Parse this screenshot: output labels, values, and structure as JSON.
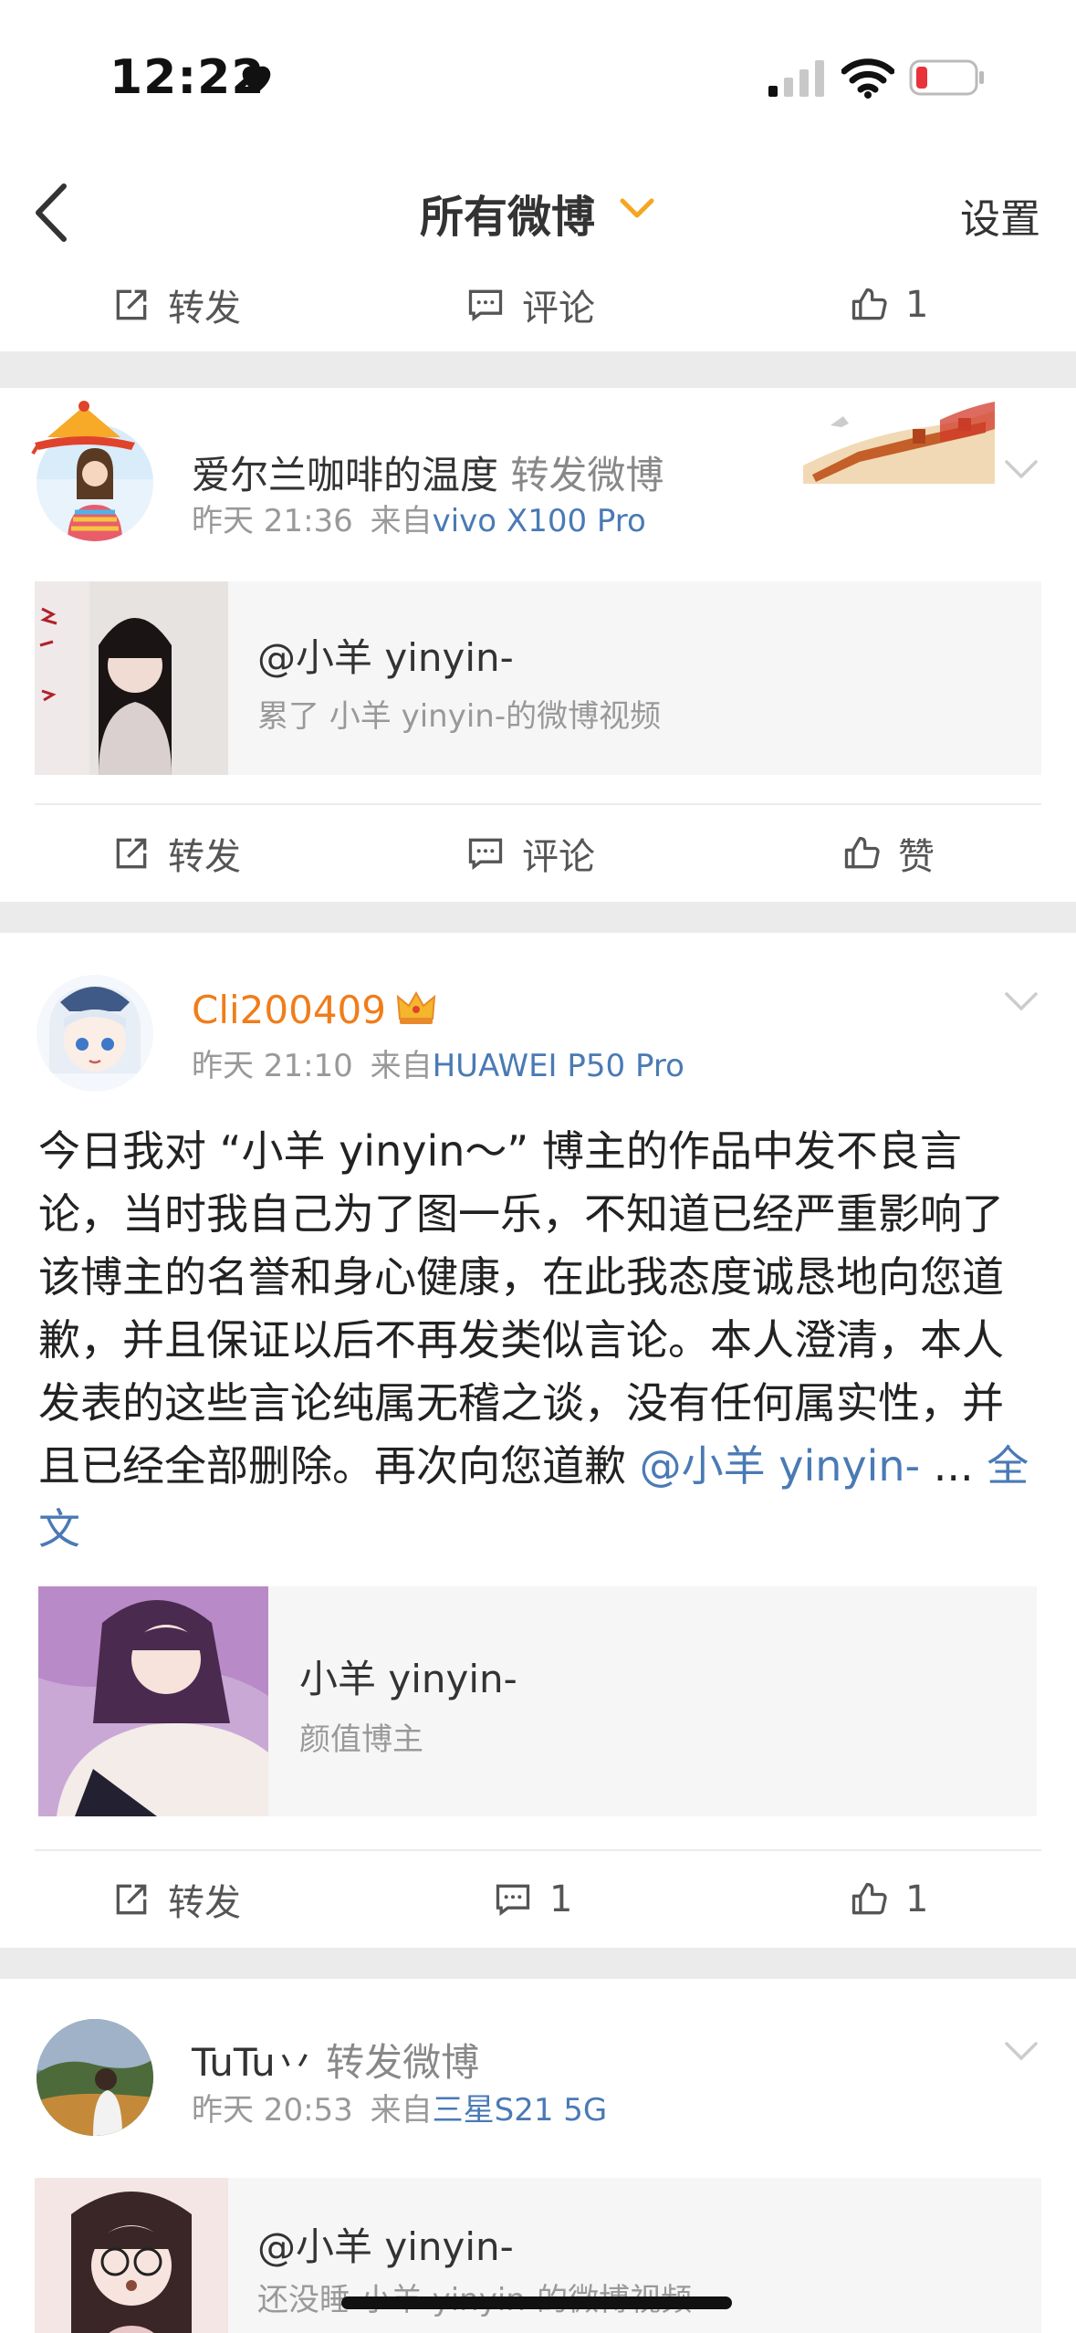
{
  "status_bar": {
    "time": "12:22"
  },
  "nav": {
    "title": "所有微博",
    "settings": "设置"
  },
  "top_actions": {
    "repost": "转发",
    "comment": "评论",
    "like": "1"
  },
  "posts": [
    {
      "username": "爱尔兰咖啡的温度",
      "repost_tag": "转发微博",
      "time": "昨天 21:36",
      "source_prefix": "来自",
      "device": "vivo X100 Pro",
      "embed": {
        "title": "@小羊 yinyin-",
        "subtitle": "累了 小羊 yinyin-的微博视频"
      },
      "actions": {
        "repost": "转发",
        "comment": "评论",
        "like": "赞"
      }
    },
    {
      "username": "Cli200409",
      "time": "昨天 21:10",
      "source_prefix": "来自",
      "device": "HUAWEI P50 Pro",
      "text": "今日我对 “小羊 yinyin～” 博主的作品中发不良言论，当时我自己为了图一乐，不知道已经严重影响了该博主的名誉和身心健康，在此我态度诚恳地向您道歉，并且保证以后不再发类似言论。本人澄清，本人发表的这些言论纯属无稽之谈，没有任何属实性，并且已经全部删除。再次向您道歉",
      "mention": "@小羊 yinyin-",
      "ellipsis": "...",
      "full_text": "全文",
      "embed": {
        "title": "小羊 yinyin-",
        "subtitle": "颜值博主"
      },
      "actions": {
        "repost": "转发",
        "comment": "1",
        "like": "1"
      }
    },
    {
      "username": "TuTu丷",
      "repost_tag": "转发微博",
      "time": "昨天 20:53",
      "source_prefix": "来自",
      "device": "三星S21 5G",
      "embed": {
        "title": "@小羊 yinyin-",
        "subtitle": "还没睡 小羊 yinyin-的微博视频"
      }
    }
  ],
  "colors": {
    "link": "#4a7ab5",
    "vip_name": "#f07d1a",
    "accent": "#f5a623"
  }
}
